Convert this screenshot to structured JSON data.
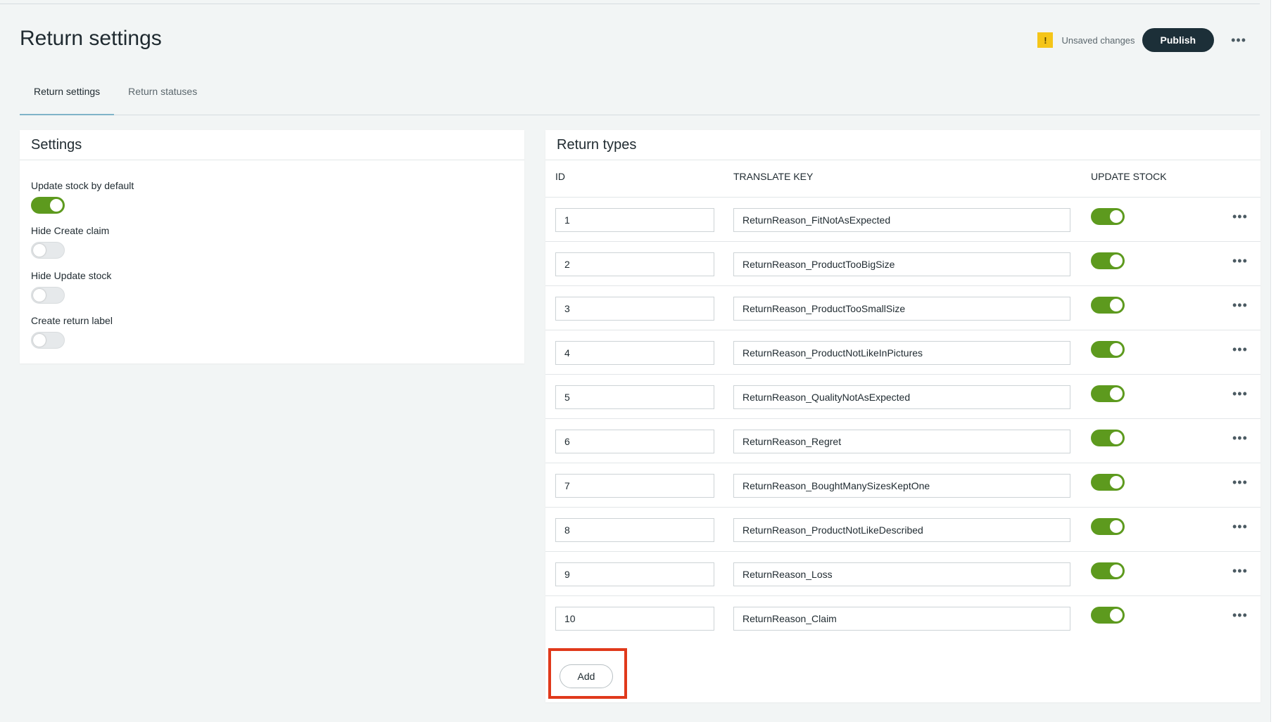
{
  "page": {
    "title": "Return settings"
  },
  "header": {
    "warning_icon": "!",
    "unsaved_text": "Unsaved changes",
    "publish_label": "Publish",
    "more_icon": "•••"
  },
  "tabs": [
    {
      "label": "Return settings",
      "active": true
    },
    {
      "label": "Return statuses",
      "active": false
    }
  ],
  "settings": {
    "title": "Settings",
    "items": [
      {
        "label": "Update stock by default",
        "on": true
      },
      {
        "label": "Hide Create claim",
        "on": false
      },
      {
        "label": "Hide Update stock",
        "on": false
      },
      {
        "label": "Create return label",
        "on": false
      }
    ]
  },
  "return_types": {
    "title": "Return types",
    "columns": {
      "id": "ID",
      "translate_key": "TRANSLATE KEY",
      "update_stock": "UPDATE STOCK"
    },
    "rows": [
      {
        "id": "1",
        "key": "ReturnReason_FitNotAsExpected",
        "update_stock": true
      },
      {
        "id": "2",
        "key": "ReturnReason_ProductTooBigSize",
        "update_stock": true
      },
      {
        "id": "3",
        "key": "ReturnReason_ProductTooSmallSize",
        "update_stock": true
      },
      {
        "id": "4",
        "key": "ReturnReason_ProductNotLikeInPictures",
        "update_stock": true
      },
      {
        "id": "5",
        "key": "ReturnReason_QualityNotAsExpected",
        "update_stock": true
      },
      {
        "id": "6",
        "key": "ReturnReason_Regret",
        "update_stock": true
      },
      {
        "id": "7",
        "key": "ReturnReason_BoughtManySizesKeptOne",
        "update_stock": true
      },
      {
        "id": "8",
        "key": "ReturnReason_ProductNotLikeDescribed",
        "update_stock": true
      },
      {
        "id": "9",
        "key": "ReturnReason_Loss",
        "update_stock": true
      },
      {
        "id": "10",
        "key": "ReturnReason_Claim",
        "update_stock": true
      }
    ],
    "row_more_icon": "•••",
    "add_label": "Add"
  },
  "colors": {
    "toggle_on": "#5d9a1e",
    "publish_bg": "#1c2f38",
    "warning": "#f5c518",
    "highlight": "#e0391b"
  }
}
